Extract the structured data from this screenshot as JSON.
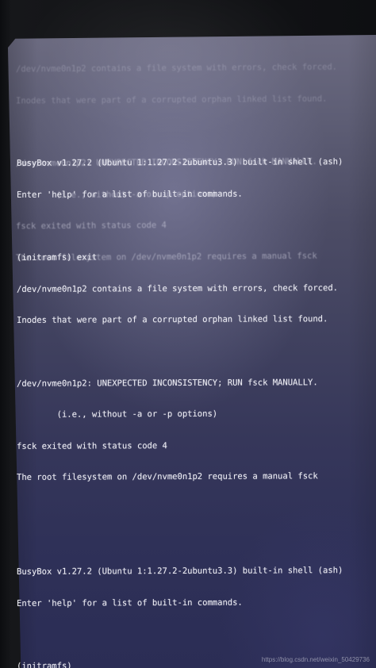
{
  "ghost_lines": [
    "/dev/nvme0n1p2 contains a file system with errors, check forced.",
    "Inodes that were part of a corrupted orphan linked list found.",
    "",
    "/dev/nvme0n1p2: UNEXPECTED INCONSISTENCY; RUN fsck MANUALLY.",
    "        (i.e., without -a or -p options)",
    "fsck exited with status code 4",
    "The root filesystem on /dev/nvme0n1p2 requires a manual fsck",
    "",
    "",
    "BusyBox v1.27.2 (Ubuntu 1:1.27.2-2ubuntu3.3) built-in shell (ash)",
    "Enter 'help' for a list of built-in commands.",
    "",
    "(initramfs) exit"
  ],
  "terminal_lines": [
    "BusyBox v1.27.2 (Ubuntu 1:1.27.2-2ubuntu3.3) built-in shell (ash)",
    "Enter 'help' for a list of built-in commands.",
    "",
    "(initramfs) exit",
    "/dev/nvme0n1p2 contains a file system with errors, check forced.",
    "Inodes that were part of a corrupted orphan linked list found.",
    "",
    "/dev/nvme0n1p2: UNEXPECTED INCONSISTENCY; RUN fsck MANUALLY.",
    "        (i.e., without -a or -p options)",
    "fsck exited with status code 4",
    "The root filesystem on /dev/nvme0n1p2 requires a manual fsck",
    "",
    "",
    "BusyBox v1.27.2 (Ubuntu 1:1.27.2-2ubuntu3.3) built-in shell (ash)",
    "Enter 'help' for a list of built-in commands.",
    ""
  ],
  "prompt": "(initramfs) ",
  "watermark": "https://blog.csdn.net/weixin_50429736"
}
